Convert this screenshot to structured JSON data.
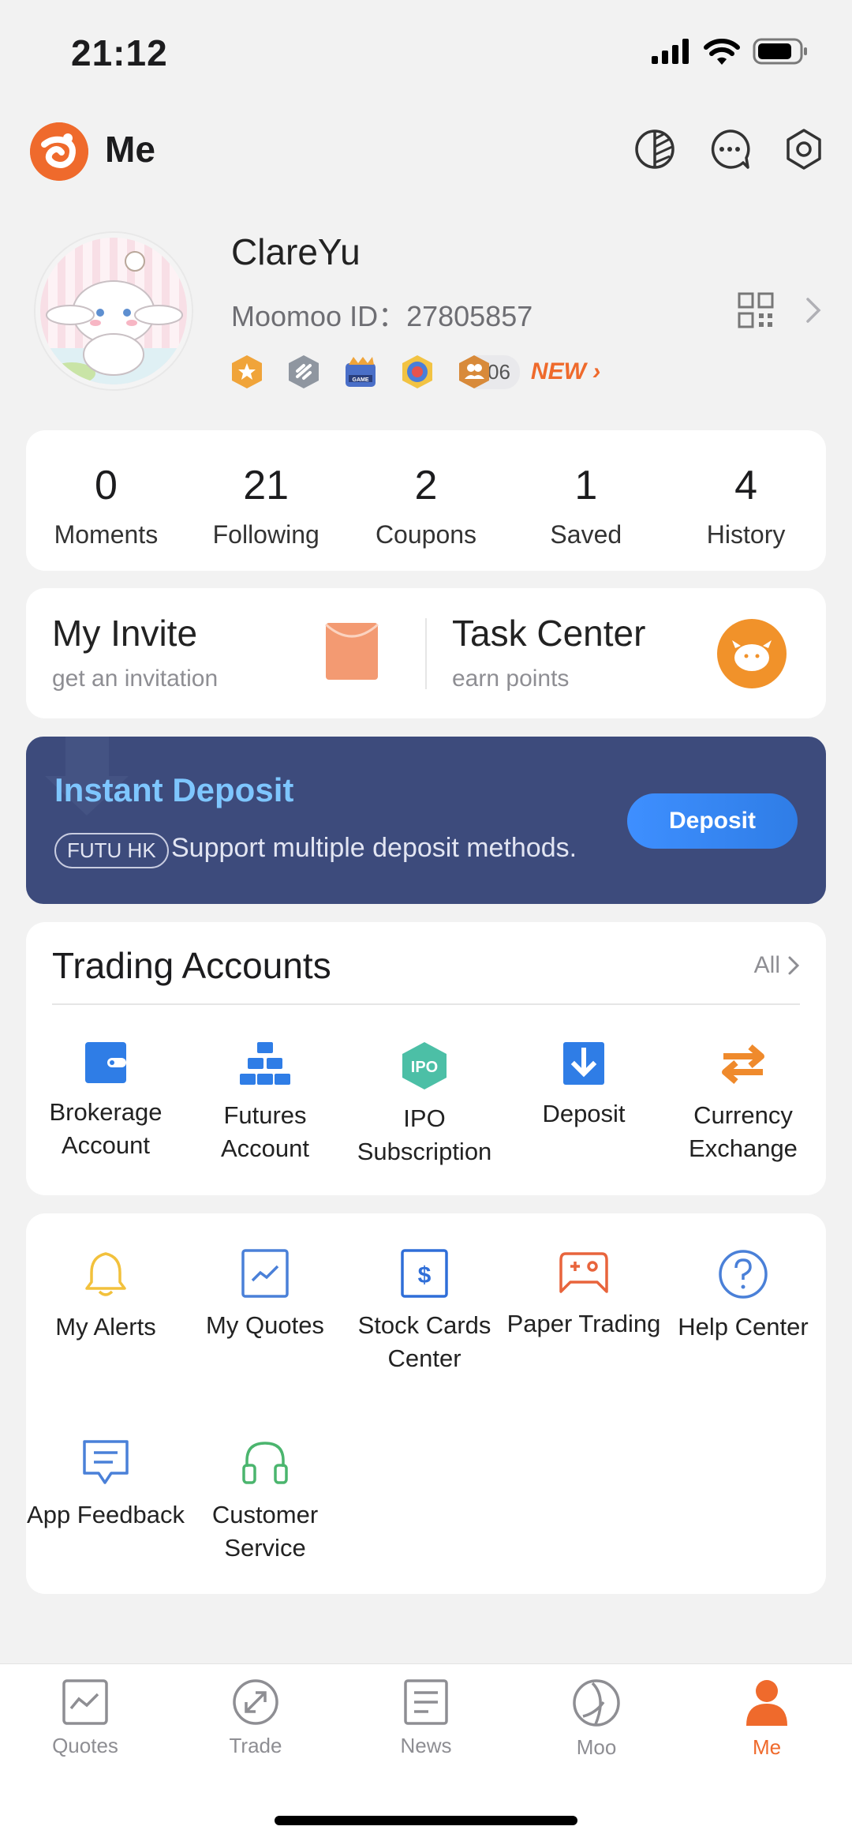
{
  "status_bar": {
    "time": "21:12"
  },
  "header": {
    "title": "Me"
  },
  "profile": {
    "username": "ClareYu",
    "moomoo_id": "Moomoo ID：27805857",
    "badge_count": "06",
    "new_label": "NEW",
    "badges": [
      "star-medal-icon",
      "shield-badge-icon",
      "game-badge-icon",
      "target-badge-icon",
      "people-badge-icon"
    ]
  },
  "stats": [
    {
      "value": "0",
      "label": "Moments"
    },
    {
      "value": "21",
      "label": "Following"
    },
    {
      "value": "2",
      "label": "Coupons"
    },
    {
      "value": "1",
      "label": "Saved"
    },
    {
      "value": "4",
      "label": "History"
    }
  ],
  "invite": {
    "title": "My Invite",
    "subtitle": "get an invitation"
  },
  "task_center": {
    "title": "Task Center",
    "subtitle": "earn points"
  },
  "deposit_banner": {
    "title": "Instant Deposit",
    "tag": "FUTU HK",
    "subtitle": "Support multiple deposit methods.",
    "button": "Deposit"
  },
  "trading": {
    "title": "Trading Accounts",
    "all": "All",
    "items": [
      {
        "line1": "Brokerage",
        "line2": "Account",
        "icon": "wallet-icon"
      },
      {
        "line1": "Futures",
        "line2": "Account",
        "icon": "gold-bars-icon"
      },
      {
        "line1": "IPO",
        "line2": "Subscription",
        "icon": "ipo-icon",
        "icon_text": "IPO"
      },
      {
        "line1": "Deposit",
        "line2": "",
        "icon": "deposit-icon"
      },
      {
        "line1": "Currency",
        "line2": "Exchange",
        "icon": "exchange-icon"
      }
    ]
  },
  "tools": [
    {
      "line1": "My Alerts",
      "line2": ""
    },
    {
      "line1": "My Quotes",
      "line2": ""
    },
    {
      "line1": "Stock Cards",
      "line2": "Center"
    },
    {
      "line1": "Paper Trading",
      "line2": ""
    },
    {
      "line1": "Help Center",
      "line2": ""
    },
    {
      "line1": "App Feedback",
      "line2": ""
    },
    {
      "line1": "Customer",
      "line2": "Service"
    }
  ],
  "nav": [
    {
      "label": "Quotes"
    },
    {
      "label": "Trade"
    },
    {
      "label": "News"
    },
    {
      "label": "Moo"
    },
    {
      "label": "Me"
    }
  ],
  "colors": {
    "accent": "#ef6a2c",
    "primary_blue": "#2f7de6",
    "banner_bg": "#3d4b7c",
    "teal": "#4cbfa6"
  }
}
